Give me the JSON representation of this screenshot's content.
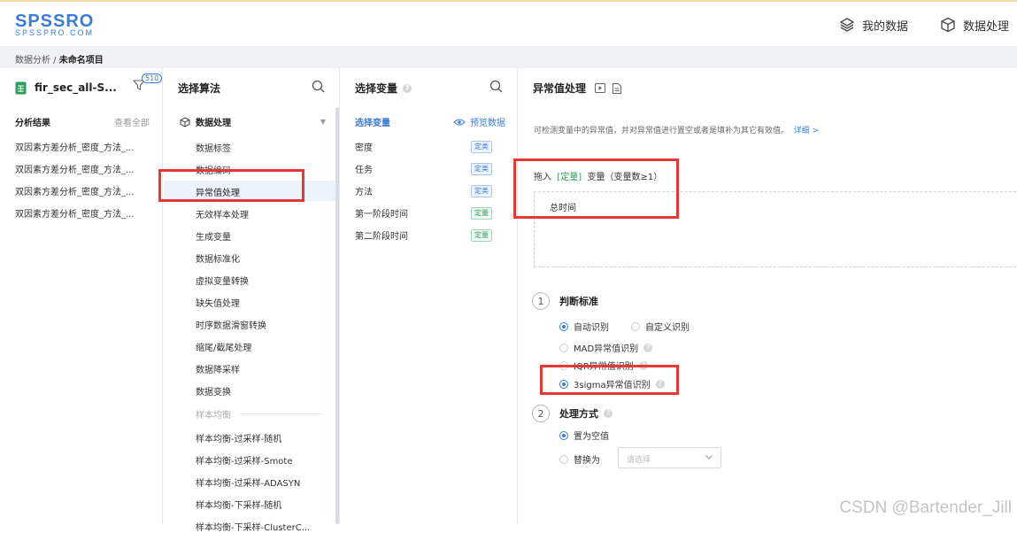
{
  "logo": {
    "main": "SPSSRO",
    "sub": "SPSSPRO.COM"
  },
  "topnav": {
    "my_data": "我的数据",
    "data_process": "数据处理"
  },
  "breadcrumb": {
    "parent": "数据分析",
    "sep": " / ",
    "current": "未命名项目"
  },
  "left": {
    "file_name": "fir_sec_all-S...",
    "badge": "510",
    "results_title": "分析结果",
    "view_all": "查看全部",
    "results": [
      "双因素方差分析_密度_方法_...",
      "双因素方差分析_密度_方法_...",
      "双因素方差分析_密度_方法_...",
      "双因素方差分析_密度_方法_..."
    ]
  },
  "algo": {
    "title": "选择算法",
    "category": "数据处理",
    "items": [
      "数据标签",
      "数据编码",
      "异常值处理",
      "无效样本处理",
      "生成变量",
      "数据标准化",
      "虚拟变量转换",
      "缺失值处理",
      "时序数据滑窗转换",
      "缩尾/截尾处理",
      "数据降采样",
      "数据变换"
    ],
    "group2": "样本均衡",
    "items2": [
      "样本均衡-过采样-随机",
      "样本均衡-过采样-Smote",
      "样本均衡-过采样-ADASYN",
      "样本均衡-下采样-随机",
      "样本均衡-下采样-ClusterC..."
    ]
  },
  "vars": {
    "title": "选择变量",
    "sub_title": "选择变量",
    "preview": "预览数据",
    "items": [
      {
        "name": "密度",
        "tag": "定类",
        "kind": "blue"
      },
      {
        "name": "任务",
        "tag": "定类",
        "kind": "blue"
      },
      {
        "name": "方法",
        "tag": "定类",
        "kind": "blue"
      },
      {
        "name": "第一阶段时间",
        "tag": "定量",
        "kind": "green"
      },
      {
        "name": "第二阶段时间",
        "tag": "定量",
        "kind": "green"
      }
    ]
  },
  "config": {
    "title": "异常值处理",
    "desc": "可检测变量中的异常值，并对异常值进行置空或者是填补为其它有效值。",
    "detail": "详细 >",
    "drag_prefix": "拖入",
    "drag_tag": "[定量]",
    "drag_suffix": "变量（变量数≥1）",
    "dropped": "总时间",
    "step1": {
      "num": "1",
      "label": "判断标准"
    },
    "opt_auto": "自动识别",
    "opt_custom": "自定义识别",
    "opt_mad": "MAD异常值识别",
    "opt_iqr": "IQR异常值识别",
    "opt_3sigma": "3sigma异常值识别",
    "step2": {
      "num": "2",
      "label": "处理方式"
    },
    "opt_null": "置为空值",
    "opt_replace": "替换为",
    "select_placeholder": "请选择"
  },
  "watermark": "CSDN @Bartender_Jill",
  "colors": {
    "accent": "#3a7bd5",
    "green": "#2e9c5d",
    "highlight": "#e53935"
  }
}
